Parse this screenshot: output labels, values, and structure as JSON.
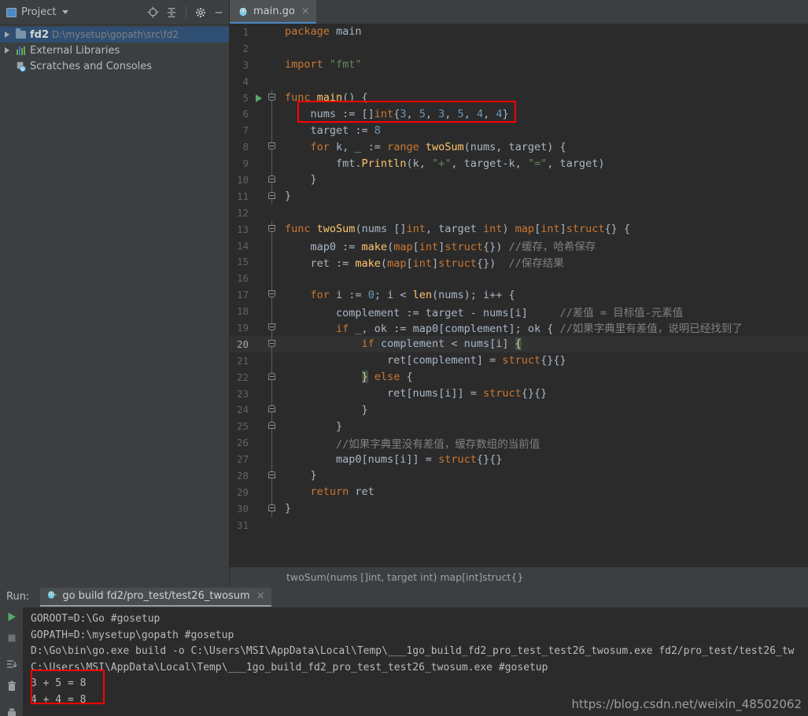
{
  "project_panel": {
    "title": "Project",
    "icons": [
      "locate-icon",
      "collapse-all-icon",
      "settings-gear-icon",
      "minimize-icon"
    ],
    "tree": [
      {
        "label": "fd2",
        "path": "D:\\mysetup\\gopath\\src\\fd2",
        "icon": "folder-icon",
        "expandable": true,
        "selected": true
      },
      {
        "label": "External Libraries",
        "path": "",
        "icon": "libraries-icon",
        "expandable": true,
        "selected": false
      },
      {
        "label": "Scratches and Consoles",
        "path": "",
        "icon": "scratches-icon",
        "expandable": false,
        "selected": false
      }
    ]
  },
  "editor": {
    "tab": {
      "label": "main.go",
      "icon": "go-gopher-icon",
      "close": "×"
    },
    "breadcrumb": "twoSum(nums []int, target int) map[int]struct{}",
    "current_line": 20,
    "lines": [
      {
        "n": 1,
        "html": "<span class=\"kw\">package</span> <span class=\"pl\">main</span>"
      },
      {
        "n": 2,
        "html": ""
      },
      {
        "n": 3,
        "html": "<span class=\"kw\">import</span> <span class=\"str\">\"fmt\"</span>"
      },
      {
        "n": 4,
        "html": ""
      },
      {
        "n": 5,
        "html": "<span class=\"kw\">func</span> <span class=\"fn\">main</span>() {",
        "fold": "down",
        "run": true
      },
      {
        "n": 6,
        "html": "    nums := []<span class=\"kw\">int</span>{<span class=\"num\">3</span>, <span class=\"num\">5</span>, <span class=\"num\">3</span>, <span class=\"num\">5</span>, <span class=\"num\">4</span>, <span class=\"num\">4</span>}",
        "bar": true
      },
      {
        "n": 7,
        "html": "    target := <span class=\"num\">8</span>",
        "bar": true
      },
      {
        "n": 8,
        "html": "    <span class=\"kw\">for</span> k, _ := <span class=\"kw\">range</span> <span class=\"fn\">twoSum</span>(nums, target) {",
        "fold": "down",
        "bar": true
      },
      {
        "n": 9,
        "html": "        fmt.<span class=\"fn\">Println</span>(k, <span class=\"str\">\"+\"</span>, target-k, <span class=\"str\">\"=\"</span>, target)",
        "bar": true
      },
      {
        "n": 10,
        "html": "    }",
        "fold": "up",
        "bar": true
      },
      {
        "n": 11,
        "html": "}",
        "fold": "up"
      },
      {
        "n": 12,
        "html": ""
      },
      {
        "n": 13,
        "html": "<span class=\"kw\">func</span> <span class=\"fn\">twoSum</span>(nums []<span class=\"kw\">int</span>, target <span class=\"kw\">int</span>) <span class=\"kw\">map</span>[<span class=\"kw\">int</span>]<span class=\"kw\">struct</span>{} {",
        "fold": "down"
      },
      {
        "n": 14,
        "html": "    map0 := <span class=\"fn\">make</span>(<span class=\"kw\">map</span>[<span class=\"kw\">int</span>]<span class=\"kw\">struct</span>{}) <span class=\"com\">//缓存，哈希保存</span>",
        "bar": true
      },
      {
        "n": 15,
        "html": "    ret := <span class=\"fn\">make</span>(<span class=\"kw\">map</span>[<span class=\"kw\">int</span>]<span class=\"kw\">struct</span>{})  <span class=\"com\">//保存结果</span>",
        "bar": true
      },
      {
        "n": 16,
        "html": "",
        "bar": true
      },
      {
        "n": 17,
        "html": "    <span class=\"kw\">for</span> i := <span class=\"num\">0</span>; i &lt; <span class=\"fn\">len</span>(nums); i++ {",
        "fold": "down",
        "bar": true
      },
      {
        "n": 18,
        "html": "        complement := target - nums[i]     <span class=\"com\">//差值 = 目标值-元素值</span>",
        "bar": true
      },
      {
        "n": 19,
        "html": "        <span class=\"kw\">if</span> _, ok := map0[complement]; ok { <span class=\"com\">//如果字典里有差值，说明已经找到了</span>",
        "fold": "down",
        "bar": true
      },
      {
        "n": 20,
        "html": "            <span class=\"kw\">if</span> complement &lt; nums[i] <span class=\"brace-hl\">{</span>",
        "fold": "down",
        "bar": true
      },
      {
        "n": 21,
        "html": "                ret[complement] = <span class=\"kw\">struct</span>{}{}",
        "bar": true
      },
      {
        "n": 22,
        "html": "            <span class=\"brace-hl\">}</span> <span class=\"kw\">else</span> {",
        "fold": "up",
        "bar": true
      },
      {
        "n": 23,
        "html": "                ret[nums[i]] = <span class=\"kw\">struct</span>{}{}",
        "bar": true
      },
      {
        "n": 24,
        "html": "            }",
        "fold": "up",
        "bar": true
      },
      {
        "n": 25,
        "html": "        }",
        "fold": "up",
        "bar": true
      },
      {
        "n": 26,
        "html": "        <span class=\"com\">//如果字典里没有差值，缓存数组的当前值</span>",
        "bar": true
      },
      {
        "n": 27,
        "html": "        map0[nums[i]] = <span class=\"kw\">struct</span>{}{}",
        "bar": true
      },
      {
        "n": 28,
        "html": "    }",
        "fold": "up",
        "bar": true
      },
      {
        "n": 29,
        "html": "    <span class=\"kw\">return</span> ret",
        "bar": true
      },
      {
        "n": 30,
        "html": "}",
        "fold": "up"
      },
      {
        "n": 31,
        "html": ""
      }
    ]
  },
  "run_panel": {
    "run_label": "Run:",
    "tab_label": "go build fd2/pro_test/test26_twosum",
    "tab_icon": "go-gopher-icon",
    "tab_close": "×",
    "tools": [
      "rerun-icon",
      "stop-icon",
      "scroll-to-end-icon",
      "trash-icon",
      "print-icon"
    ],
    "output": [
      "GOROOT=D:\\Go #gosetup",
      "GOPATH=D:\\mysetup\\gopath #gosetup",
      "D:\\Go\\bin\\go.exe build -o C:\\Users\\MSI\\AppData\\Local\\Temp\\___1go_build_fd2_pro_test_test26_twosum.exe fd2/pro_test/test26_tw",
      "C:\\Users\\MSI\\AppData\\Local\\Temp\\___1go_build_fd2_pro_test_test26_twosum.exe #gosetup",
      "3 + 5 = 8",
      "4 + 4 = 8"
    ]
  },
  "watermark": "https://blog.csdn.net/weixin_48502062",
  "colors": {
    "annotation_red": "#ff0000",
    "editor_bg": "#2b2b2b",
    "panel_bg": "#3c3f41",
    "accent_blue": "#4a88c7"
  }
}
